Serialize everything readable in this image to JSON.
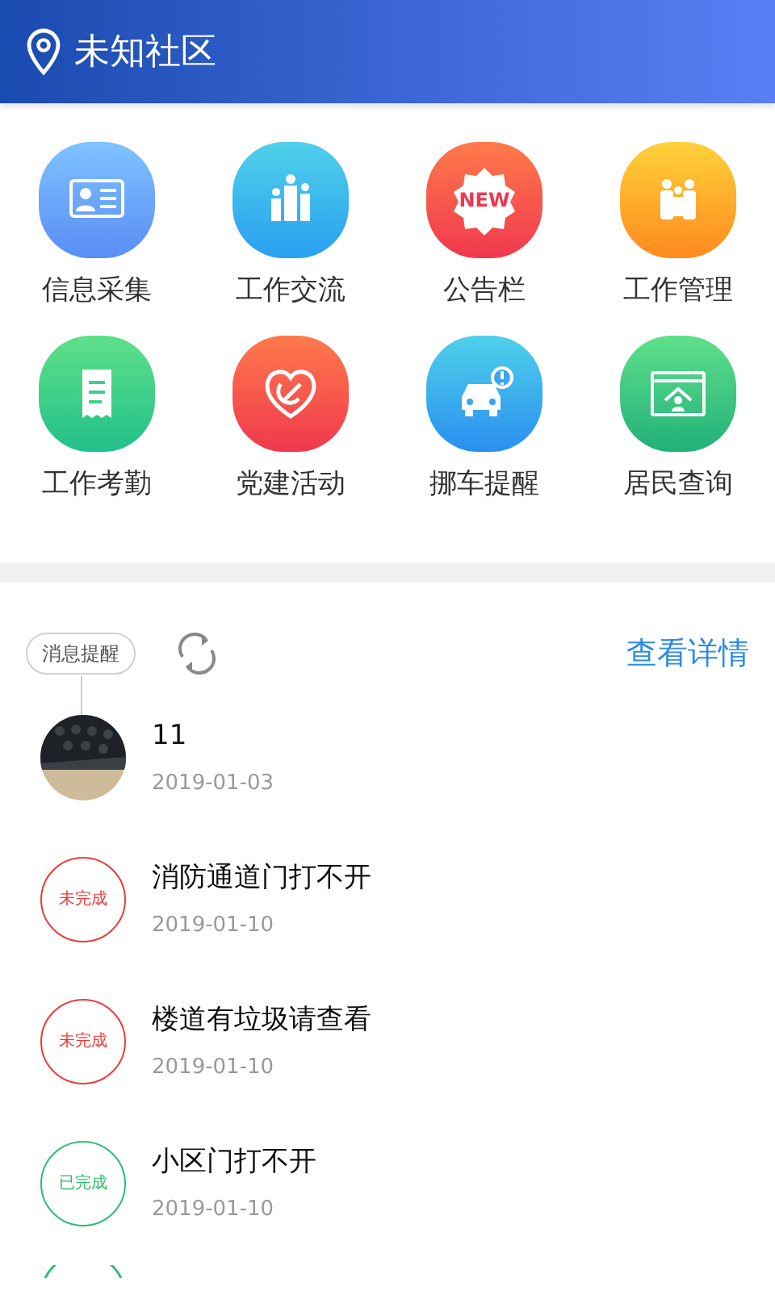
{
  "header": {
    "title": "未知社区"
  },
  "grid": [
    {
      "label": "信息采集"
    },
    {
      "label": "工作交流"
    },
    {
      "label": "公告栏",
      "badge": "NEW"
    },
    {
      "label": "工作管理"
    },
    {
      "label": "工作考勤"
    },
    {
      "label": "党建活动"
    },
    {
      "label": "挪车提醒"
    },
    {
      "label": "居民查询"
    }
  ],
  "messages": {
    "tag": "消息提醒",
    "link": "查看详情",
    "items": [
      {
        "title": "11",
        "date": "2019-01-03"
      },
      {
        "kind": "stamp",
        "done": false,
        "stamp": "未完成",
        "title": "消防通道门打不开",
        "date": "2019-01-10"
      },
      {
        "kind": "stamp",
        "done": false,
        "stamp": "未完成",
        "title": "楼道有垃圾请查看",
        "date": "2019-01-10"
      },
      {
        "kind": "stamp",
        "done": true,
        "stamp": "已完成",
        "title": "小区门打不开",
        "date": "2019-01-10"
      },
      {
        "kind": "partial",
        "done": true
      }
    ]
  }
}
